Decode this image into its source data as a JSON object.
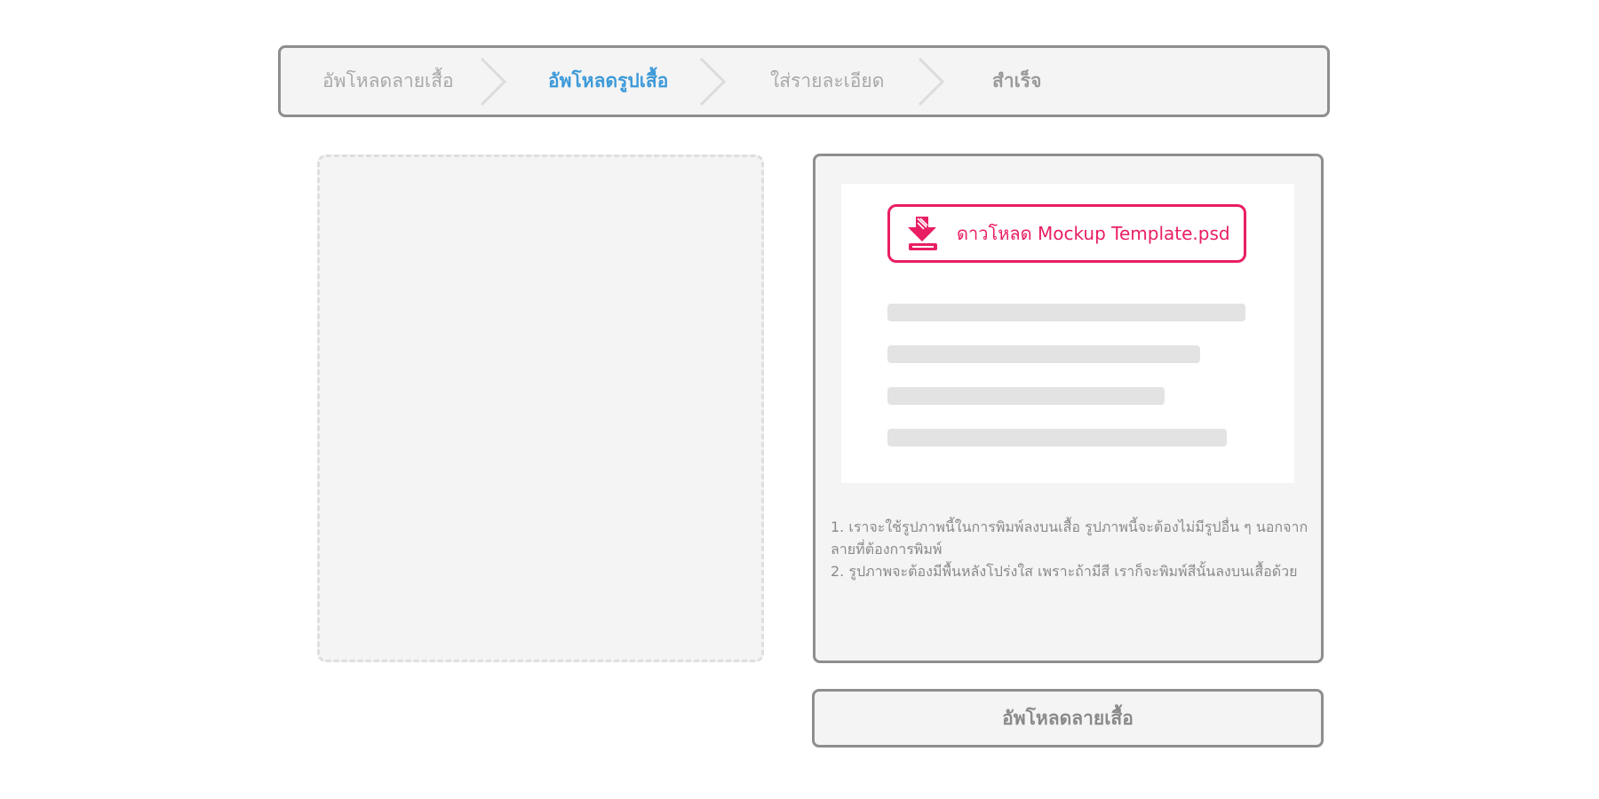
{
  "stepper": {
    "steps": [
      {
        "label": "อัพโหลดลายเสื้อ",
        "state": "done"
      },
      {
        "label": "อัพโหลดรูปเสื้อ",
        "state": "active"
      },
      {
        "label": "ใส่รายละเอียด",
        "state": "pending"
      },
      {
        "label": "สำเร็จ",
        "state": "pending"
      }
    ],
    "separator_icon": "chevron-right-icon",
    "colors": {
      "active": "#3d9ad9",
      "inactive": "#a9a9a9",
      "border": "#8e8e8e"
    }
  },
  "upload_area": {
    "style": "dashed"
  },
  "instructions": {
    "download_button": {
      "label": "ดาวโหลด Mockup Template.psd",
      "icon": "download-arrow-icon",
      "color": "#e91e63"
    },
    "notes": [
      "1. เราจะใช้รูปภาพนี้ในการพิมพ์ลงบนเสื้อ รูปภาพนี้จะต้องไม่มีรูปอื่น ๆ นอกจากลายที่ต้องการพิมพ์",
      "2. รูปภาพจะต้องมีพื้นหลังโปร่งใส เพราะถ้ามีสี เราก็จะพิมพ์สีนั้นลงบนเสื้อด้วย"
    ]
  },
  "submit_button": {
    "label": "อัพโหลดลายเสื้อ"
  }
}
